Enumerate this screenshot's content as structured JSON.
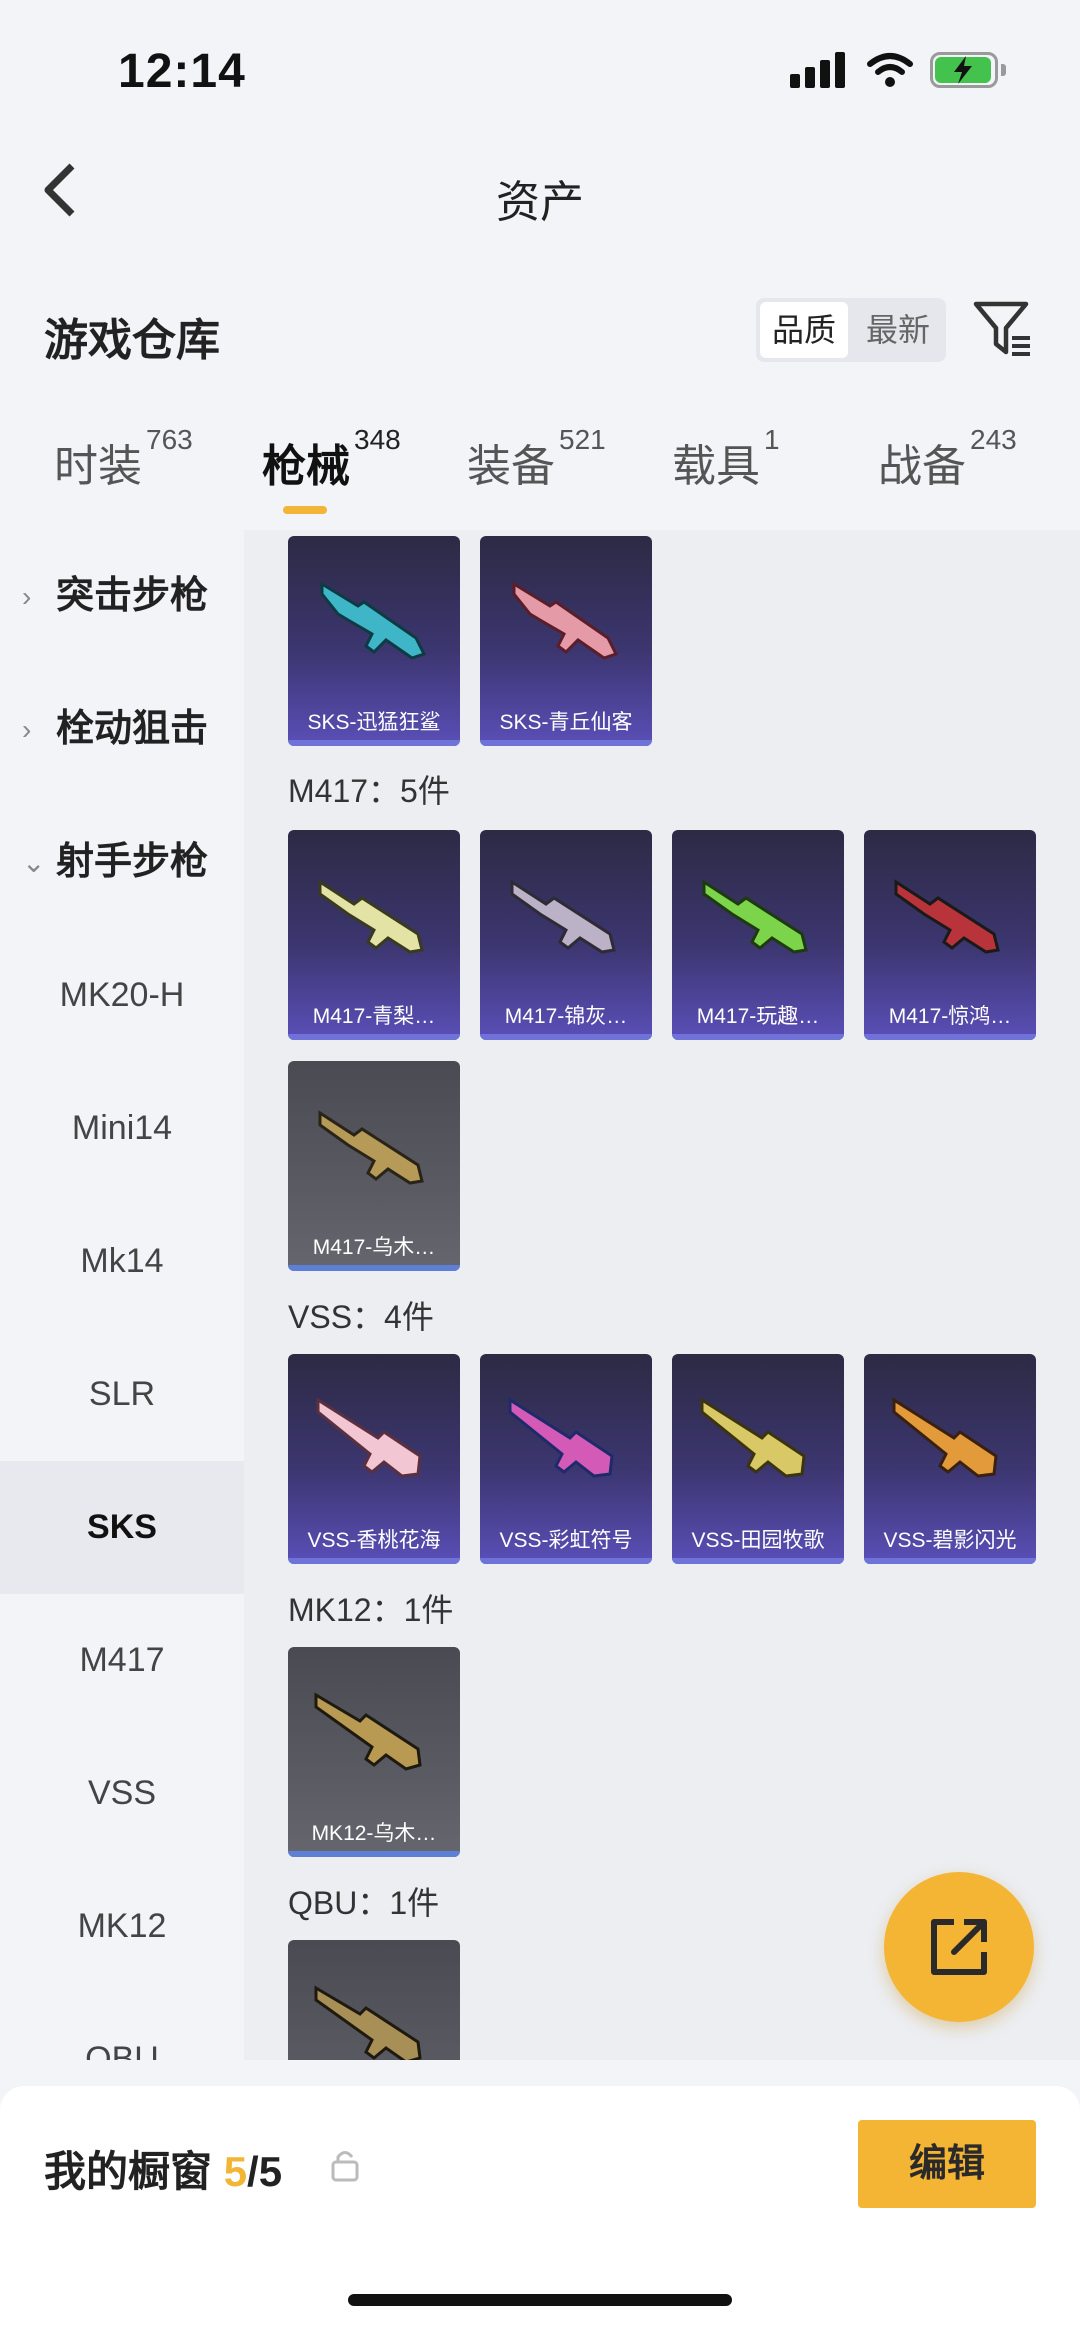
{
  "status_bar": {
    "time": "12:14"
  },
  "header": {
    "title": "资产"
  },
  "warehouse": {
    "title": "游戏仓库",
    "sort_options": [
      "品质",
      "最新"
    ],
    "sort_selected": "品质"
  },
  "tabs": [
    {
      "label": "时装",
      "count": "763"
    },
    {
      "label": "枪械",
      "count": "348",
      "active": true
    },
    {
      "label": "装备",
      "count": "521"
    },
    {
      "label": "载具",
      "count": "1"
    },
    {
      "label": "战备",
      "count": "243"
    }
  ],
  "sidebar": {
    "groups": [
      {
        "label": "突击步枪",
        "chevron": "›"
      },
      {
        "label": "栓动狙击",
        "chevron": "›"
      },
      {
        "label": "射手步枪",
        "chevron": "⌄"
      }
    ],
    "items": [
      "MK20-H",
      "Mini14",
      "Mk14",
      "SLR",
      "SKS",
      "M417",
      "VSS",
      "MK12",
      "QBU"
    ],
    "selected": "SKS"
  },
  "sections": {
    "sks": {
      "items": [
        "SKS-迅猛狂鲨",
        "SKS-青丘仙客"
      ]
    },
    "m417": {
      "title": "M417：5件",
      "items": [
        "M417-青梨…",
        "M417-锦灰…",
        "M417-玩趣…",
        "M417-惊鸿…",
        "M417-乌木…"
      ]
    },
    "vss": {
      "title": "VSS：4件",
      "items": [
        "VSS-香桃花海",
        "VSS-彩虹符号",
        "VSS-田园牧歌",
        "VSS-碧影闪光"
      ]
    },
    "mk12": {
      "title": "MK12：1件",
      "items": [
        "MK12-乌木…"
      ]
    },
    "qbu": {
      "title": "QBU：1件"
    }
  },
  "bottom_bar": {
    "label": "我的橱窗",
    "current": "5",
    "total": "/5",
    "edit_label": "编辑"
  },
  "colors": {
    "accent": "#f4b434",
    "card_purple": "#3c3670",
    "card_gray": "#5a5a62"
  },
  "icons": [
    "back-icon",
    "filter-icon",
    "share-icon",
    "lock-icon",
    "signal-icon",
    "wifi-icon",
    "battery-icon"
  ]
}
